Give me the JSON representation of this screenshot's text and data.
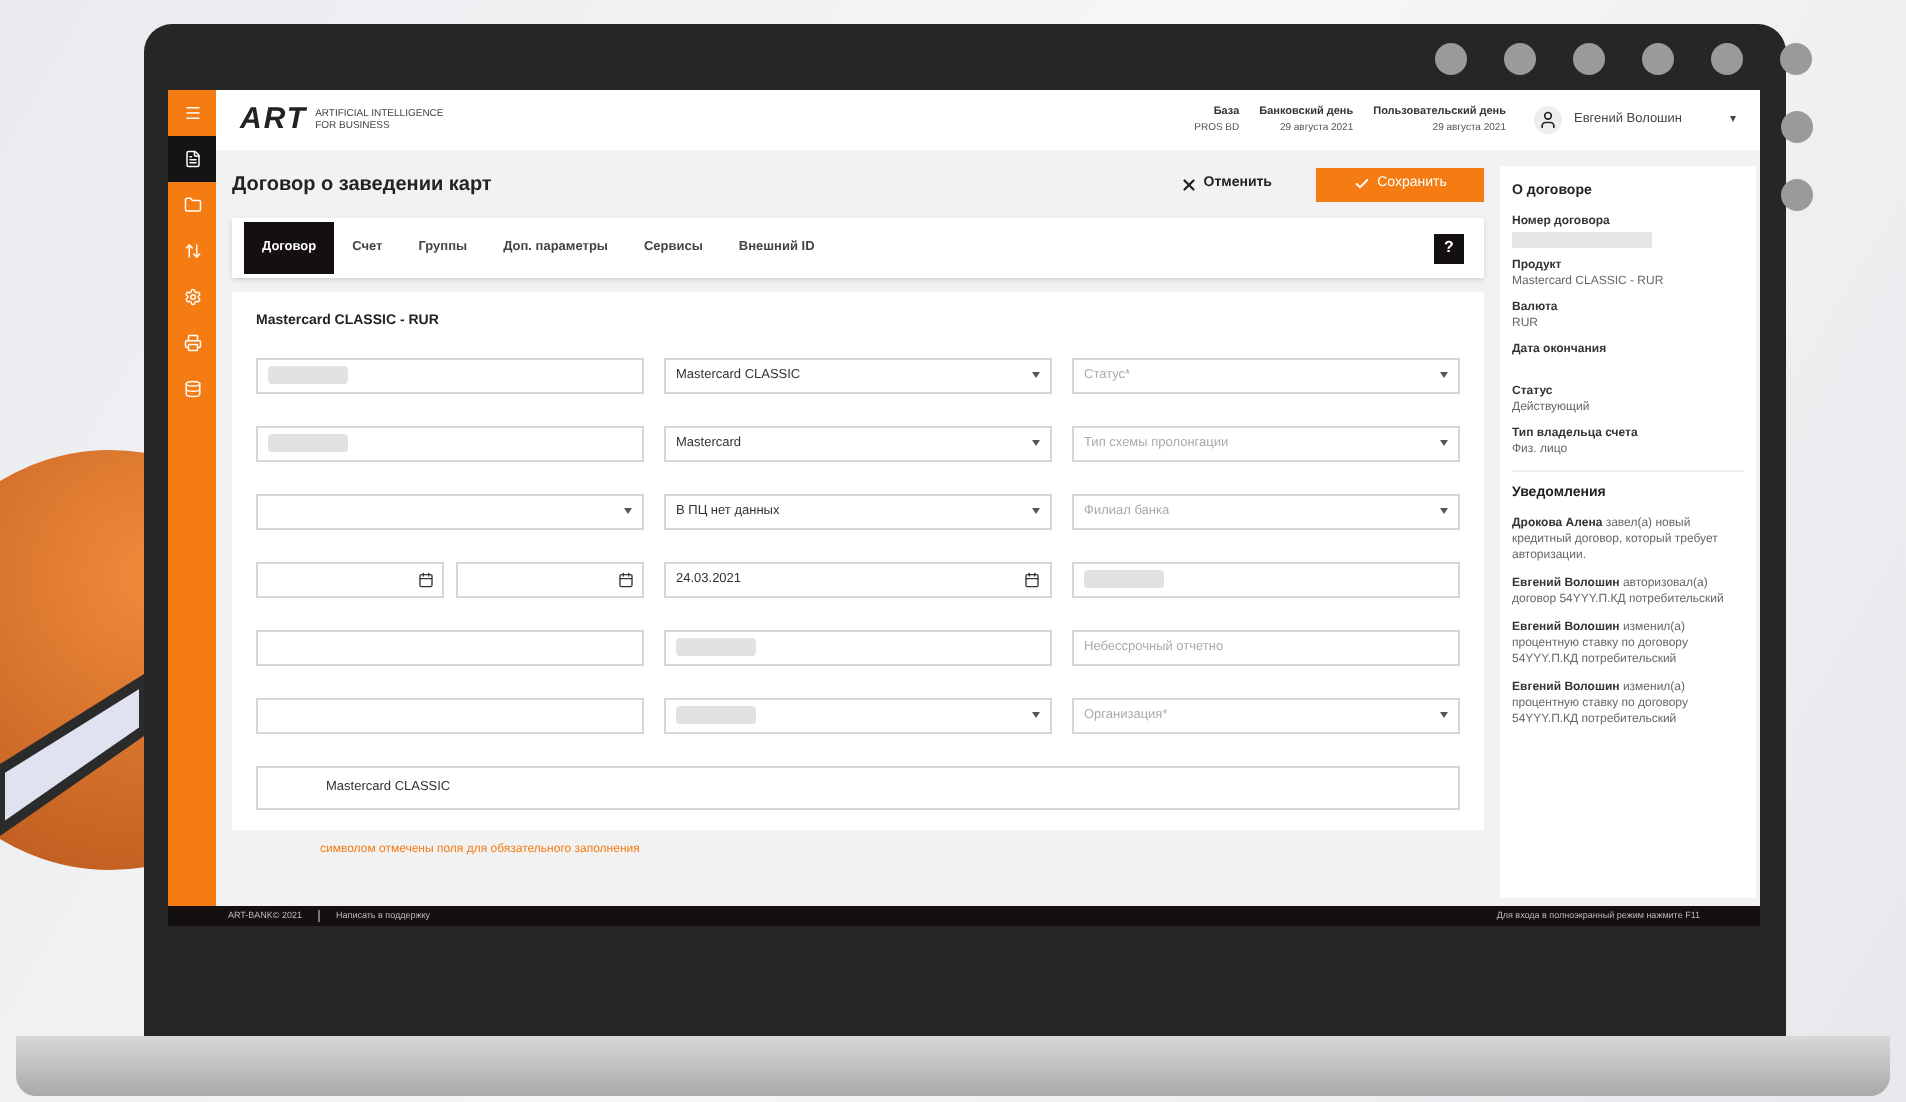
{
  "header": {
    "logo": "ART",
    "tagline_1": "ARTIFICIAL INTELLIGENCE",
    "tagline_2": "FOR BUSINESS",
    "info": [
      {
        "label": "База",
        "value": "PROS BD"
      },
      {
        "label": "Банковский день",
        "value": "29 августа 2021"
      },
      {
        "label": "Пользовательский день",
        "value": "29 августа 2021"
      }
    ],
    "user": "Евгений Волошин",
    "menu_caret": "▾"
  },
  "sidebar": {
    "items": [
      {
        "selected": false
      },
      {
        "selected": true
      },
      {
        "selected": false
      },
      {
        "selected": false
      },
      {
        "selected": false
      },
      {
        "selected": false
      },
      {
        "selected": false
      }
    ]
  },
  "page": {
    "title": "Договор о заведении карт",
    "cancel": "Отменить",
    "save": "Сохранить",
    "help": "?"
  },
  "tabs": [
    {
      "label": "Договор",
      "selected": true
    },
    {
      "label": "Счет",
      "selected": false
    },
    {
      "label": "Группы",
      "selected": false
    },
    {
      "label": "Доп. параметры",
      "selected": false
    },
    {
      "label": "Сервисы",
      "selected": false
    },
    {
      "label": "Внешний ID",
      "selected": false
    }
  ],
  "form": {
    "title": "Mastercard CLASSIC - RUR",
    "rows": [
      [
        {
          "kind": "text",
          "redacted": true
        },
        {
          "kind": "select",
          "value": "Mastercard CLASSIC"
        },
        {
          "kind": "select",
          "placeholder": "Статус*"
        }
      ],
      [
        {
          "kind": "text",
          "redacted": true
        },
        {
          "kind": "select",
          "value": "Mastercard"
        },
        {
          "kind": "select",
          "placeholder": "Тип схемы пролонгации"
        }
      ],
      [
        {
          "kind": "select"
        },
        {
          "kind": "select",
          "value": "В ПЦ нет данных"
        },
        {
          "kind": "select",
          "placeholder": "Филиал банка"
        }
      ],
      [
        {
          "kind": "datepair"
        },
        {
          "kind": "date",
          "value": "24.03.2021"
        },
        {
          "kind": "text",
          "redacted": true
        }
      ],
      [
        {
          "kind": "text"
        },
        {
          "kind": "text",
          "redacted": true
        },
        {
          "kind": "text",
          "placeholder": "Небессрочный отчетно"
        }
      ],
      [
        {
          "kind": "text"
        },
        {
          "kind": "select",
          "redacted": true
        },
        {
          "kind": "select",
          "placeholder": "Организация*"
        }
      ]
    ],
    "wide": {
      "value": "Mastercard CLASSIC"
    },
    "note": "символом отмечены поля для обязательного заполнения"
  },
  "footer": {
    "copyright": "ART-BANK© 2021",
    "support": "Написать в поддержку",
    "hint": "Для входа в полноэкранный режим нажмите F11"
  },
  "panel": {
    "title": "О договоре",
    "fields": [
      {
        "label": "Номер договора",
        "redacted": true
      },
      {
        "label": "Продукт",
        "value": "Mastercard CLASSIC - RUR"
      },
      {
        "label": "Валюта",
        "value": "RUR"
      },
      {
        "label": "Дата окончания"
      },
      {
        "label": "Статус",
        "value": "Действующий"
      },
      {
        "label": "Тип владельца счета",
        "value": "Физ. лицо"
      }
    ],
    "notifications_title": "Уведомления",
    "notifications": [
      {
        "author": "Дрокова Алена",
        "text": "завел(а) новый кредитный договор, который требует авторизации."
      },
      {
        "author": "Евгений Волошин",
        "text": "авторизовал(а) договор 54YYY.П.КД потребительский"
      },
      {
        "author": "Евгений Волошин",
        "text": "изменил(а) процентную ставку по договору 54YYY.П.КД потребительский"
      },
      {
        "author": "Евгений Волошин",
        "text": "изменил(а) процентную ставку по договору 54YYY.П.КД потребительский"
      }
    ]
  }
}
